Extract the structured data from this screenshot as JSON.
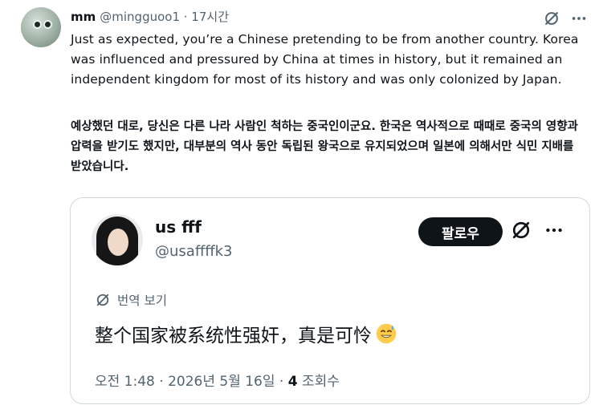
{
  "tweet": {
    "display_name": "mm",
    "handle_time": "@mingguoo1 · 17시간",
    "text_en": "Just as expected, you’re a Chinese pretending to be from another country. Korea was influenced and pressured by China at times in history, but it remained an independent kingdom for most of its history and was only colonized by Japan.",
    "text_ko": "예상했던 대로, 당신은 다른 나라 사람인 척하는 중국인이군요. 한국은 역사적으로 때때로 중국의 영향과 압력을 받기도 했지만, 대부분의 역사 동안 독립된 왕국으로 유지되었으며 일본에 의해서만 식민 지배를 받았습니다."
  },
  "quoted": {
    "display_name": "us fff",
    "handle": "@usaffffk3",
    "follow_label": "팔로우",
    "translate_label": "번역 보기",
    "text_zh": "整个国家被系统性强奸，真是可怜",
    "meta_prefix": "오전 1:48 · 2026년 5월 16일 · ",
    "views_count": "4",
    "views_label": " 조회수"
  },
  "icons": {
    "grok": "grok-slash-icon",
    "more": "more-dots-icon",
    "translate": "globe-translate-icon",
    "emoji": "sweat-smile-emoji"
  },
  "colors": {
    "text_primary": "#0f1419",
    "text_secondary": "#536471",
    "border": "#cfd9de",
    "follow_bg": "#0f1419"
  }
}
